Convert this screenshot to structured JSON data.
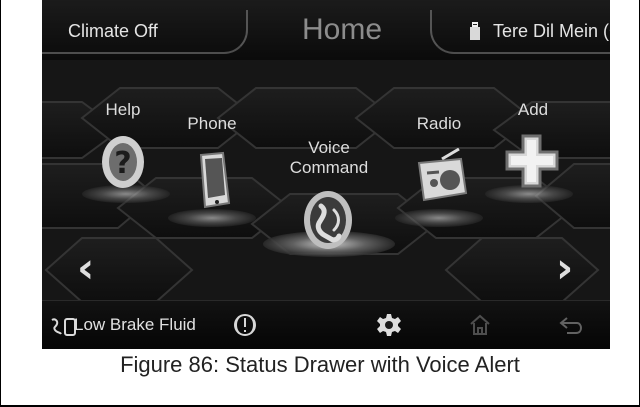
{
  "top_bar": {
    "climate_label": "Climate Off",
    "title": "Home",
    "media_label": "Tere Dil Mein (Cl..."
  },
  "apps": [
    {
      "label": "Help",
      "icon": "help-icon"
    },
    {
      "label": "Phone",
      "icon": "phone-icon"
    },
    {
      "label": "Voice Command",
      "label_line1": "Voice",
      "label_line2": "Command",
      "icon": "voice-command-icon"
    },
    {
      "label": "Radio",
      "icon": "radio-icon"
    },
    {
      "label": "Add",
      "icon": "add-plus-icon"
    }
  ],
  "navigation": {
    "previous_icon": "chevron-left-icon",
    "next_icon": "chevron-right-icon"
  },
  "status_drawer": {
    "alert_text": "Low Brake Fluid",
    "alert_icon": "voice-alert-icon",
    "warning_icon": "brake-warning-icon",
    "settings_icon": "gear-icon",
    "home_icon": "home-icon",
    "back_icon": "back-icon"
  },
  "caption": "Figure 86: Status Drawer with Voice Alert"
}
